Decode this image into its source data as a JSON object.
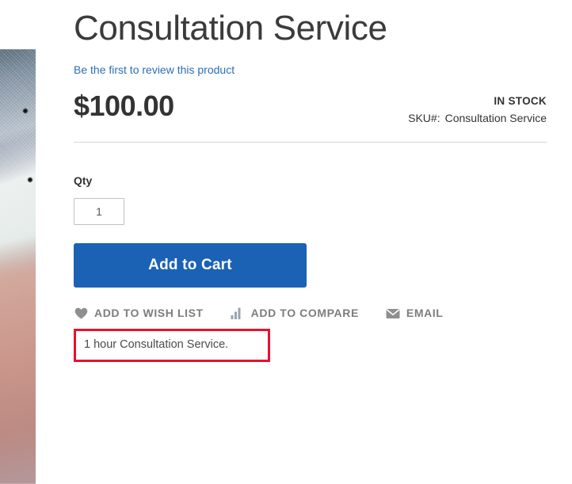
{
  "product": {
    "title": "Consultation Service",
    "review_link": "Be the first to review this product",
    "price": "$100.00",
    "stock_status": "IN STOCK",
    "sku_label": "SKU#:",
    "sku_value": "Consultation Service",
    "qty_label": "Qty",
    "qty_value": "1",
    "qty_placeholder": "1",
    "add_to_cart_label": "Add to Cart",
    "description": "1 hour Consultation Service."
  },
  "actions": [
    {
      "label": "ADD TO WISH LIST",
      "icon": "heart-icon"
    },
    {
      "label": "ADD TO COMPARE",
      "icon": "compare-bars-icon"
    },
    {
      "label": "EMAIL",
      "icon": "envelope-icon"
    }
  ],
  "media": {
    "product_image_alt": "Consultation service photo"
  },
  "colors": {
    "accent_blue": "#1b62b5",
    "link_blue": "#2b6eb5",
    "highlight_red": "#e8112d",
    "text_dark": "#333333",
    "text_muted": "#7d7d7d"
  }
}
